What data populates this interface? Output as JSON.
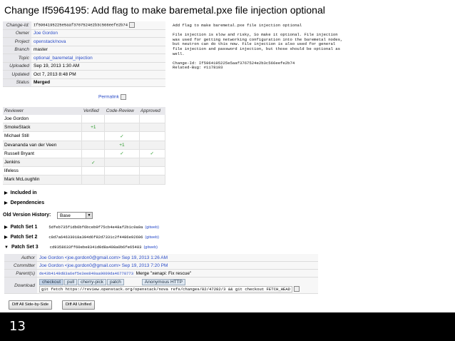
{
  "title": "Change If5964195: Add flag to make baremetal.pxe file injection optional",
  "info": [
    {
      "key": "Change-Id:",
      "value": "If5964195225e5aaf3767524e2b3c566eefe2b74",
      "mono": true,
      "link": false,
      "copy": true
    },
    {
      "key": "Owner",
      "value": "Joe Gordon",
      "link": true
    },
    {
      "key": "Project",
      "value": "openstack/nova",
      "link": true
    },
    {
      "key": "Branch",
      "value": "master",
      "link": false
    },
    {
      "key": "Topic",
      "value": "optional_baremetal_injection",
      "link": true
    },
    {
      "key": "Uploaded",
      "value": "Sep 19, 2013 1:30 AM",
      "link": false
    },
    {
      "key": "Updated",
      "value": "Oct 7, 2013 8:48 PM",
      "link": false
    },
    {
      "key": "Status",
      "value": "Merged",
      "link": false,
      "bold": true
    }
  ],
  "permalink": "Permalink",
  "message": "Add flag to make baremetal.pxe file injection optional\n\nFile injection is slow and risky, So make it optional. File injection\nwas used for getting networking configuration into the baremetal nodes,\nbut neutron can do this now. File injection is also used for general\nfile injection and password injection, but those should be optional as\nwell.\n\nChange-Id: If5964195225e5aaf3767524e2b3c566eefe2b74\nRelated-Bug: #1178103",
  "approvals": {
    "headers": [
      "Reviewer",
      "Verified",
      "Code-Review",
      "Approved"
    ],
    "rows": [
      {
        "name": "Joe Gordon",
        "v": "",
        "cr": "",
        "a": ""
      },
      {
        "name": "SmokeStack",
        "v": "+1",
        "cr": "",
        "a": ""
      },
      {
        "name": "Michael Still",
        "v": "",
        "cr": "✓",
        "a": ""
      },
      {
        "name": "Devananda van der Veen",
        "v": "",
        "cr": "+1",
        "a": ""
      },
      {
        "name": "Russell Bryant",
        "v": "",
        "cr": "✓",
        "a": "✓"
      },
      {
        "name": "Jenkins",
        "v": "✓",
        "cr": "",
        "a": ""
      },
      {
        "name": "lifeless",
        "v": "",
        "cr": "",
        "a": ""
      },
      {
        "name": "Mark McLoughlin",
        "v": "",
        "cr": "",
        "a": ""
      }
    ]
  },
  "sections": {
    "included_in": "Included in",
    "dependencies": "Dependencies"
  },
  "old_version": {
    "label": "Old Version History:",
    "selected": "Base"
  },
  "patch_sets": [
    {
      "label": "Patch Set 1",
      "rev": "5dfeb735f1db6bf6bceb9f75cb4e48af2b1c0a9a",
      "gitweb": "(gitweb)",
      "expanded": false
    },
    {
      "label": "Patch Set 2",
      "rev": "c8d7a64633018a394d6f92d7331c2f4486e92606",
      "gitweb": "(gitweb)",
      "expanded": false
    },
    {
      "label": "Patch Set 3",
      "rev": "cd9358633ff60ebe8341d0d8a408a0b6fe65483",
      "gitweb": "(gitweb)",
      "expanded": true
    }
  ],
  "ps3": {
    "author_key": "Author",
    "author": "Joe Gordon <joe.gordon0@gmail.com> Sep 19, 2013 1:26 AM",
    "committer_key": "Committer",
    "committer": "Joe Gordon <joe.gordon0@gmail.com> Sep 19, 2013 7:20 PM",
    "parents_key": "Parent(s)",
    "parent_rev": "de43b4149d83a6ef5e3ee849aa9009da46778773",
    "parent_msg": "Merge \"xenapi: Fix rescue\"",
    "download_key": "Download",
    "tabs": [
      "checkout",
      "pull",
      "cherry-pick",
      "patch",
      "Anonymous HTTP"
    ],
    "command": "git fetch https://review.openstack.org/openstack/nova refs/changes/82/47282/3 && git checkout FETCH_HEAD"
  },
  "buttons": {
    "diff_side": "Diff All Side-by-Side",
    "diff_unified": "Diff All Unified"
  },
  "slide_number": "13"
}
